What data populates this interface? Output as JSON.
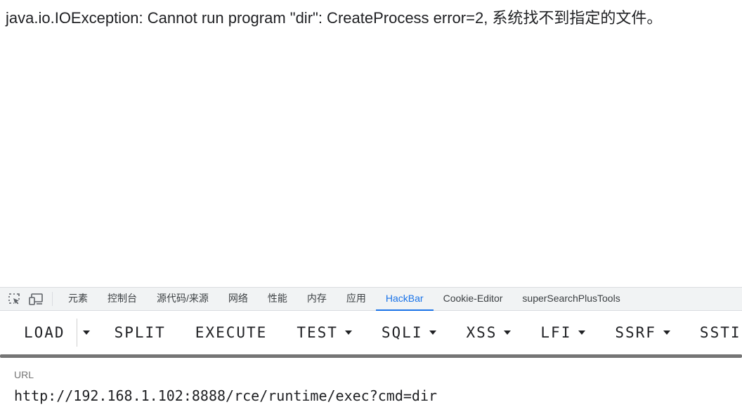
{
  "page": {
    "error_message": "java.io.IOException: Cannot run program \"dir\": CreateProcess error=2, 系统找不到指定的文件。"
  },
  "devtools": {
    "icons": [
      "inspect-element-icon",
      "device-toolbar-icon"
    ],
    "tabs": [
      {
        "label": "元素",
        "active": false
      },
      {
        "label": "控制台",
        "active": false
      },
      {
        "label": "源代码/来源",
        "active": false
      },
      {
        "label": "网络",
        "active": false
      },
      {
        "label": "性能",
        "active": false
      },
      {
        "label": "内存",
        "active": false
      },
      {
        "label": "应用",
        "active": false
      },
      {
        "label": "HackBar",
        "active": true
      },
      {
        "label": "Cookie-Editor",
        "active": false
      },
      {
        "label": "superSearchPlusTools",
        "active": false
      }
    ],
    "active_color": "#1a73e8"
  },
  "hackbar": {
    "buttons": {
      "load": "LOAD",
      "split": "SPLIT",
      "execute": "EXECUTE",
      "test": "TEST",
      "sqli": "SQLI",
      "xss": "XSS",
      "lfi": "LFI",
      "ssrf": "SSRF",
      "ssti": "SSTI"
    },
    "url_label": "URL",
    "url_value": "http://192.168.1.102:8888/rce/runtime/exec?cmd=dir"
  }
}
